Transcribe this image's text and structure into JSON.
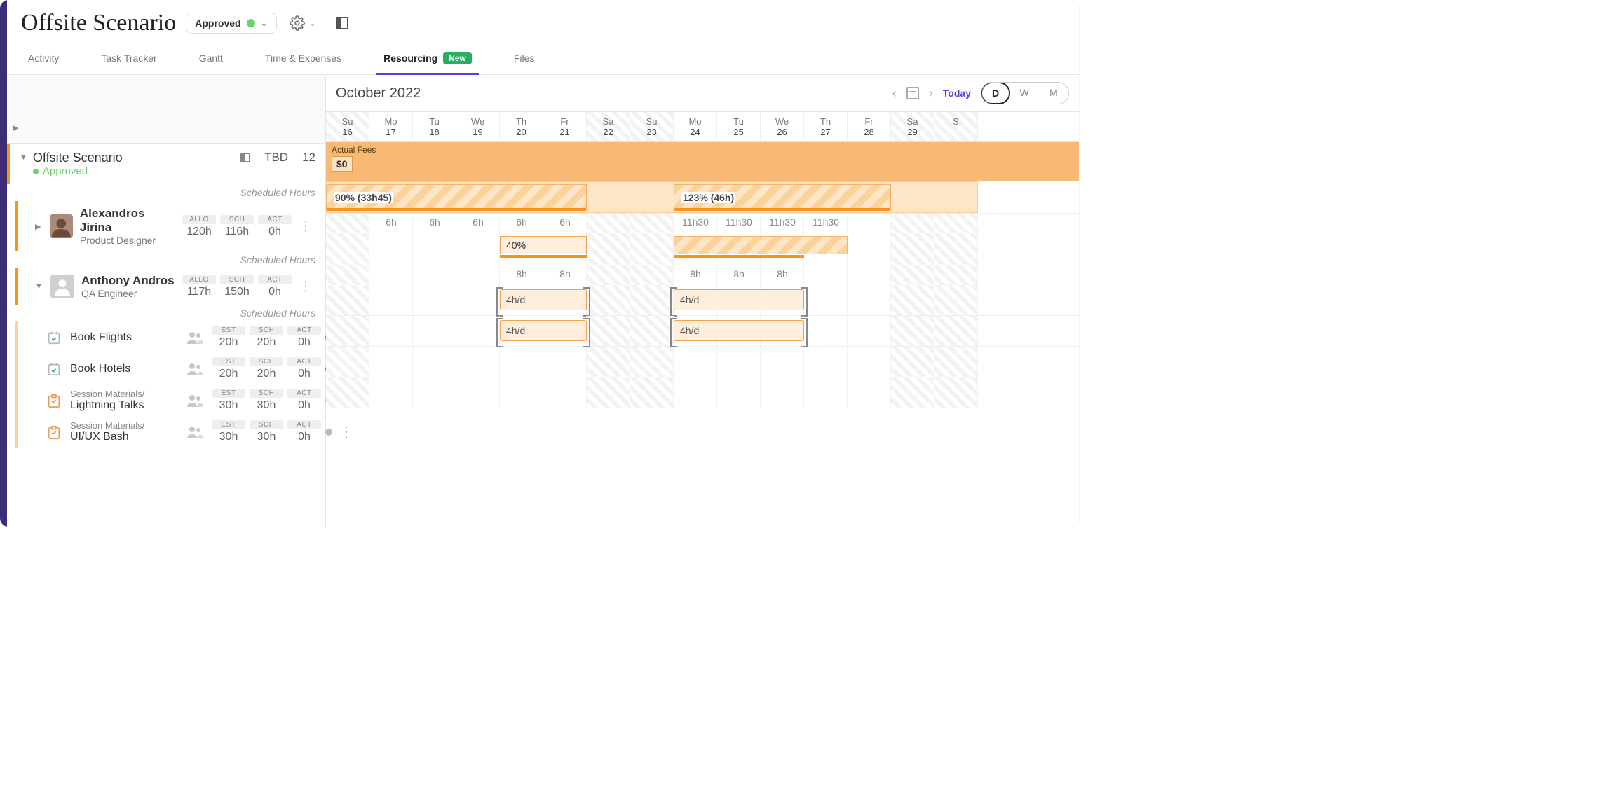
{
  "page": {
    "title": "Offsite Scenario"
  },
  "status": {
    "label": "Approved"
  },
  "tabs": {
    "activity": "Activity",
    "task_tracker": "Task Tracker",
    "gantt": "Gantt",
    "time_expenses": "Time & Expenses",
    "resourcing": "Resourcing",
    "resourcing_badge": "New",
    "files": "Files"
  },
  "timeline": {
    "month": "October 2022",
    "today": "Today",
    "view": {
      "d": "D",
      "w": "W",
      "m": "M"
    },
    "days": [
      {
        "dow": "Su",
        "num": "16",
        "wknd": true
      },
      {
        "dow": "Mo",
        "num": "17"
      },
      {
        "dow": "Tu",
        "num": "18"
      },
      {
        "dow": "We",
        "num": "19"
      },
      {
        "dow": "Th",
        "num": "20"
      },
      {
        "dow": "Fr",
        "num": "21"
      },
      {
        "dow": "Sa",
        "num": "22",
        "wknd": true
      },
      {
        "dow": "Su",
        "num": "23",
        "wknd": true
      },
      {
        "dow": "Mo",
        "num": "24"
      },
      {
        "dow": "Tu",
        "num": "25"
      },
      {
        "dow": "We",
        "num": "26"
      },
      {
        "dow": "Th",
        "num": "27"
      },
      {
        "dow": "Fr",
        "num": "28"
      },
      {
        "dow": "Sa",
        "num": "29",
        "wknd": true
      },
      {
        "dow": "S",
        "num": "",
        "wknd": true
      }
    ]
  },
  "project": {
    "name": "Offsite Scenario",
    "status": "Approved",
    "tbd": "TBD",
    "count": "12",
    "fees_label": "Actual Fees",
    "fees_value": "$0"
  },
  "labels": {
    "scheduled_hours": "Scheduled Hours",
    "allo": "ALLO",
    "sch": "SCH",
    "act": "ACT",
    "est": "EST"
  },
  "resources": [
    {
      "name": "Alexandros Jirina",
      "role": "Product Designer",
      "allo": "120h",
      "sch": "116h",
      "act": "0h",
      "bars": [
        {
          "text": "90% (33h45)"
        },
        {
          "text": "123% (46h)"
        }
      ],
      "hours": [
        "",
        "6h",
        "6h",
        "6h",
        "6h",
        "6h",
        "",
        "",
        "11h30",
        "11h30",
        "11h30",
        "11h30"
      ]
    },
    {
      "name": "Anthony Andros",
      "role": "QA Engineer",
      "allo": "117h",
      "sch": "150h",
      "act": "0h",
      "percent": "40%",
      "hours": [
        "",
        "",
        "",
        "",
        "8h",
        "8h",
        "",
        "",
        "8h",
        "8h",
        "8h"
      ]
    }
  ],
  "tasks": [
    {
      "name": "Book Flights",
      "est": "20h",
      "sch": "20h",
      "act": "0h",
      "status": "blue",
      "bar": "4h/d"
    },
    {
      "name": "Book Hotels",
      "est": "20h",
      "sch": "20h",
      "act": "0h",
      "status": "blue",
      "bar": "4h/d"
    },
    {
      "breadcrumb": "Session Materials/",
      "name": "Lightning Talks",
      "est": "30h",
      "sch": "30h",
      "act": "0h",
      "status": "grey",
      "check": true
    },
    {
      "breadcrumb": "Session Materials/",
      "name": "UI/UX Bash",
      "est": "30h",
      "sch": "30h",
      "act": "0h",
      "status": "grey",
      "check": true
    }
  ]
}
